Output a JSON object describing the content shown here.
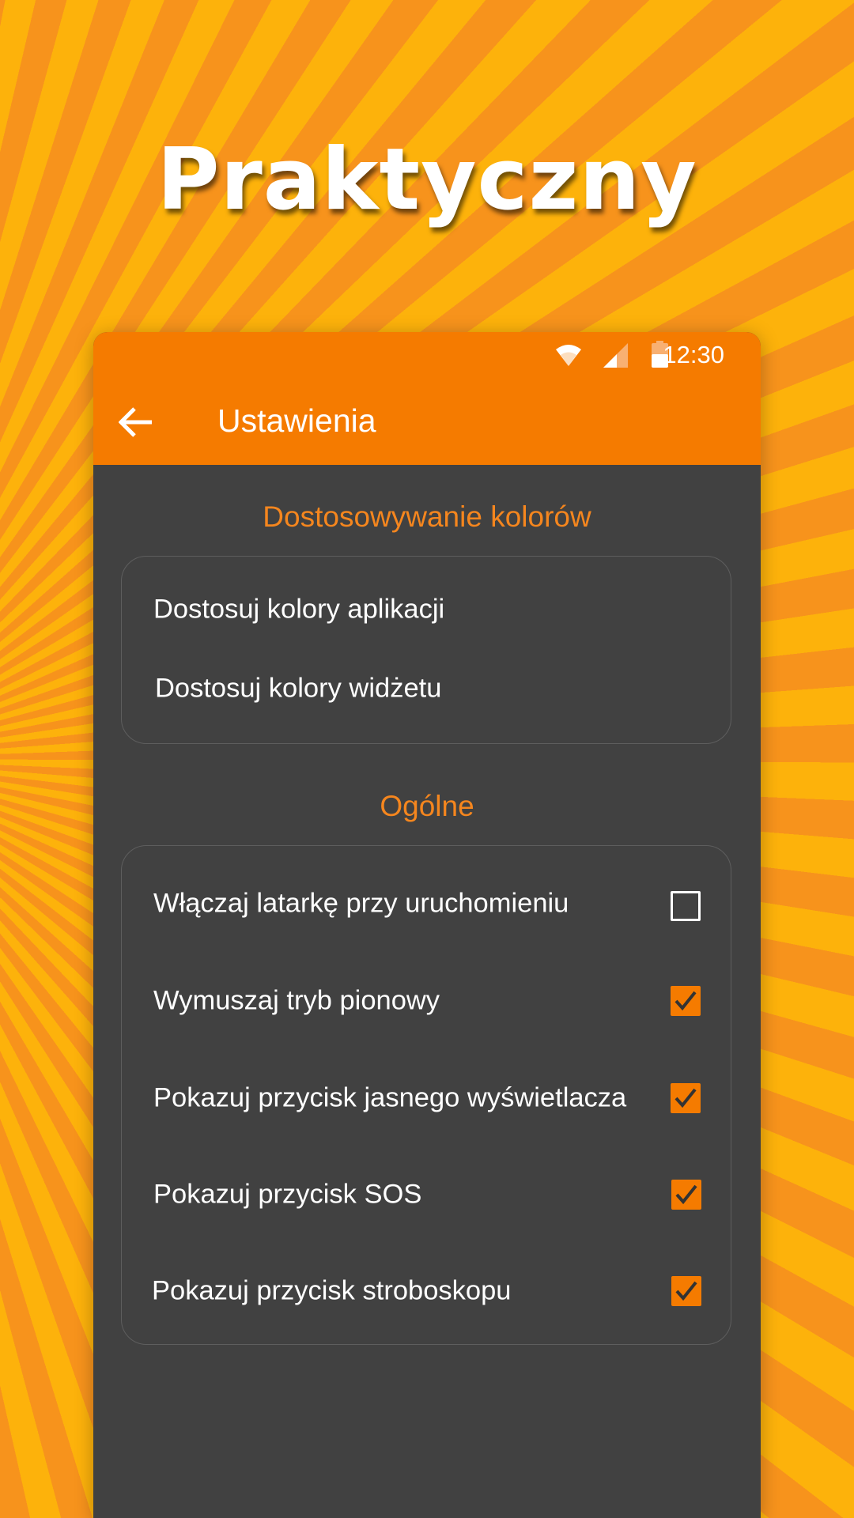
{
  "headline": "Praktyczny",
  "status_bar": {
    "time": "12:30",
    "icons": [
      "wifi-icon",
      "cell-signal-icon",
      "battery-icon"
    ]
  },
  "app_bar": {
    "title": "Ustawienia",
    "back_icon": "arrow-left-icon"
  },
  "sections": {
    "colors": {
      "title": "Dostosowywanie kolorów",
      "items": [
        {
          "label": "Dostosuj kolory aplikacji"
        },
        {
          "label": "Dostosuj kolory widżetu"
        }
      ]
    },
    "general": {
      "title": "Ogólne",
      "items": [
        {
          "label": "Włączaj latarkę przy uruchomieniu",
          "checked": false
        },
        {
          "label": "Wymuszaj tryb pionowy",
          "checked": true
        },
        {
          "label": "Pokazuj przycisk jasnego wyświetlacza",
          "checked": true
        },
        {
          "label": "Pokazuj przycisk SOS",
          "checked": true
        },
        {
          "label": "Pokazuj przycisk stroboskopu",
          "checked": true
        }
      ]
    }
  },
  "colors": {
    "accent": "#f57b00",
    "section_title": "#f5861e",
    "background_dark": "#414141",
    "backdrop_light": "#fdb20b",
    "backdrop_dark": "#f7931c"
  }
}
